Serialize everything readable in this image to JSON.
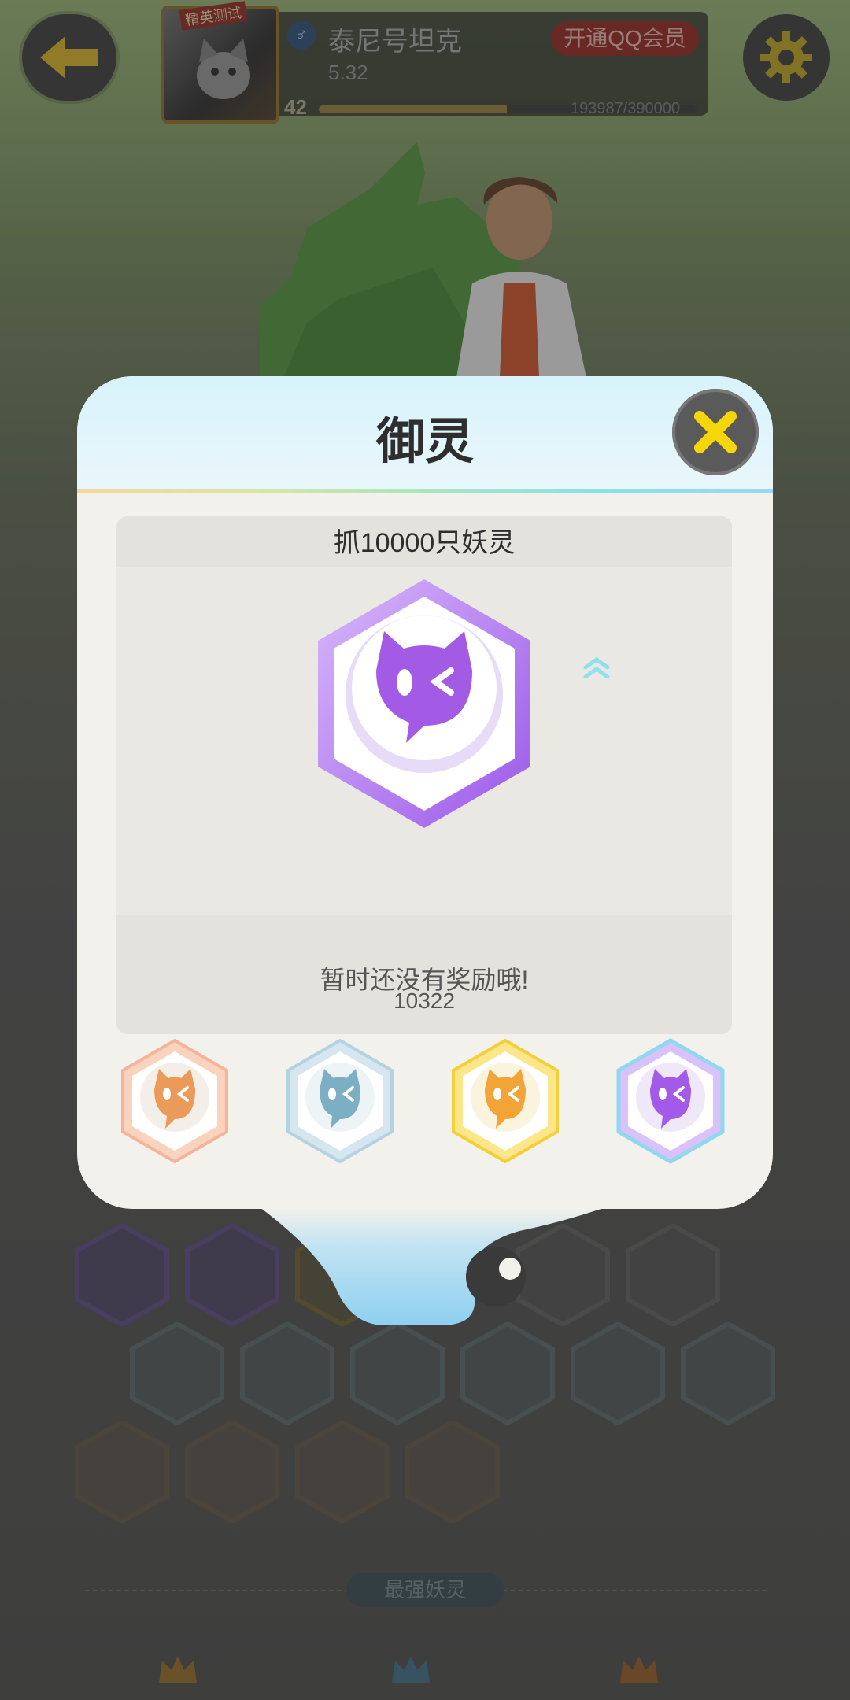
{
  "header": {
    "player_name": "泰尼号坦克",
    "player_sub": "5.32",
    "level": "42",
    "exp_text": "193987/390000",
    "exp_fraction": 0.497,
    "vip_label": "开通QQ会员",
    "avatar_tag": "精英测试"
  },
  "modal": {
    "title": "御灵",
    "card_title": "抓10000只妖灵",
    "badge_count": "10322",
    "reward_text": "暂时还没有奖励哦!",
    "tiers": [
      "bronze",
      "silver",
      "gold",
      "purple"
    ],
    "selected_tier": 3
  },
  "bottom": {
    "strongest_label": "最强妖灵"
  },
  "colors": {
    "accent_yellow": "#f5d60a",
    "badge_purple": "#a35be6",
    "tier_bronze": "#f2a269",
    "tier_silver": "#85b6c9",
    "tier_gold": "#f5c62a",
    "tier_purple": "#a45ae8"
  },
  "icons": [
    "back-arrow-icon",
    "settings-gear-icon",
    "close-x-icon",
    "male-gender-icon",
    "spirit-face-icon",
    "chevron-up-icon"
  ]
}
